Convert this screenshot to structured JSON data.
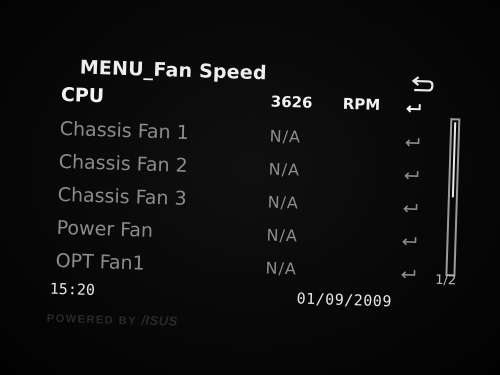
{
  "menu": {
    "title": "MENU_Fan Speed",
    "back_icon": "return-arrow-icon"
  },
  "fans": [
    {
      "name": "CPU",
      "value": "3626",
      "unit": "RPM",
      "selected": true
    },
    {
      "name": "Chassis Fan 1",
      "value": "N/A"
    },
    {
      "name": "Chassis Fan 2",
      "value": "N/A"
    },
    {
      "name": "Chassis Fan 3",
      "value": "N/A"
    },
    {
      "name": "Power Fan",
      "value": "N/A"
    },
    {
      "name": "OPT Fan1",
      "value": "N/A"
    }
  ],
  "row_icon": "enter-arrow-icon",
  "pagination": {
    "label": "1/2",
    "current": 1,
    "total": 2
  },
  "status": {
    "time": "15:20",
    "date": "01/09/2009"
  },
  "branding": {
    "powered_by": "POWERED BY",
    "brand": "/ISUS"
  },
  "colors": {
    "background": "#050505",
    "selected_text": "#f2f2f2",
    "normal_text": "#8c8c8c"
  }
}
